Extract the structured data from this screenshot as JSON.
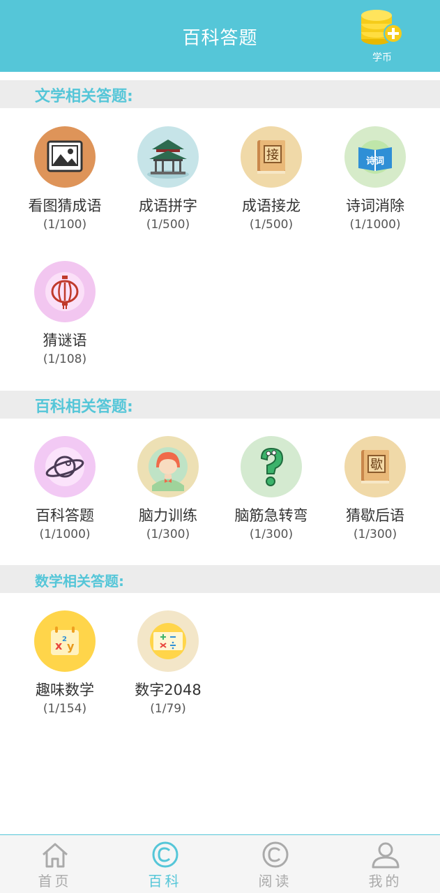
{
  "header": {
    "title": "百科答题",
    "coin_label": "学币"
  },
  "sections": [
    {
      "title": "文学相关答题:",
      "items": [
        {
          "name": "看图猜成语",
          "progress": "(1/100)",
          "icon": "picture-icon"
        },
        {
          "name": "成语拼字",
          "progress": "(1/500)",
          "icon": "pavilion-icon"
        },
        {
          "name": "成语接龙",
          "progress": "(1/500)",
          "icon": "book-jie-icon",
          "glyph": "接"
        },
        {
          "name": "诗词消除",
          "progress": "(1/1000)",
          "icon": "poetry-book-icon",
          "glyph": "诗词"
        },
        {
          "name": "猜谜语",
          "progress": "(1/108)",
          "icon": "lantern-icon"
        }
      ]
    },
    {
      "title": "百科相关答题:",
      "items": [
        {
          "name": "百科答题",
          "progress": "(1/1000)",
          "icon": "planet-icon"
        },
        {
          "name": "脑力训练",
          "progress": "(1/300)",
          "icon": "girl-avatar-icon"
        },
        {
          "name": "脑筋急转弯",
          "progress": "(1/300)",
          "icon": "question-mark-icon"
        },
        {
          "name": "猜歇后语",
          "progress": "(1/300)",
          "icon": "book-xie-icon",
          "glyph": "歇"
        }
      ]
    },
    {
      "title": "数学相关答题:",
      "items": [
        {
          "name": "趣味数学",
          "progress": "(1/154)",
          "icon": "math-xy-icon"
        },
        {
          "name": "数字2048",
          "progress": "(1/79)",
          "icon": "arithmetic-icon"
        }
      ]
    }
  ],
  "nav": {
    "items": [
      {
        "label": "首页",
        "icon": "home-icon",
        "active": false
      },
      {
        "label": "百科",
        "icon": "copyright-icon",
        "active": true
      },
      {
        "label": "阅读",
        "icon": "copyright-icon",
        "active": false
      },
      {
        "label": "我的",
        "icon": "user-icon",
        "active": false
      }
    ]
  },
  "colors": {
    "accent": "#55c6d8",
    "section_bg": "#ececec",
    "nav_bg": "#f5f5f5"
  }
}
